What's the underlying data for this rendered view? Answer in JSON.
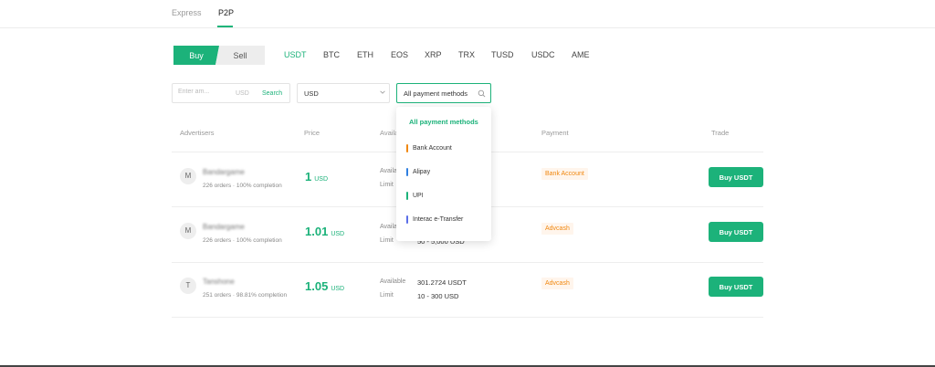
{
  "top_tabs": [
    {
      "label": "Express"
    },
    {
      "label": "P2P"
    }
  ],
  "trade_toggle": {
    "buy_label": "Buy",
    "sell_label": "Sell"
  },
  "coins": [
    "USDT",
    "BTC",
    "ETH",
    "EOS",
    "XRP",
    "TRX",
    "TUSD",
    "USDC",
    "AME"
  ],
  "filters": {
    "amount_placeholder": "Enter am...",
    "amount_unit": "USD",
    "search_label": "Search",
    "currency": "USD",
    "payment_method": "All payment methods"
  },
  "table": {
    "headers": [
      "Advertisers",
      "Price",
      "Availa",
      "Payment",
      "Trade"
    ],
    "available_label": "Available",
    "limit_label": "Limit",
    "rows": [
      {
        "initial": "M",
        "name": "Bandargame",
        "stats": "226 orders · 100% completion",
        "price": "1",
        "currency": "USD",
        "available": "",
        "limit": "",
        "payment": "Bank Account",
        "trade": "Buy USDT"
      },
      {
        "initial": "M",
        "name": "Bandargame",
        "stats": "226 orders · 100% completion",
        "price": "1.01",
        "currency": "USD",
        "available": "",
        "limit": "50 - 5,000 USD",
        "payment": "Advcash",
        "trade": "Buy USDT"
      },
      {
        "initial": "T",
        "name": "Tanshone",
        "stats": "251 orders · 98.81% completion",
        "price": "1.05",
        "currency": "USD",
        "available": "301.2724 USDT",
        "limit": "10 - 300 USD",
        "payment": "Advcash",
        "trade": "Buy USDT"
      }
    ]
  },
  "payment_dropdown": {
    "items": [
      {
        "label": "All payment methods",
        "color": "#1cb27a"
      },
      {
        "label": "Bank Account",
        "color": "#f0870f"
      },
      {
        "label": "Alipay",
        "color": "#2f7fe0"
      },
      {
        "label": "UPI",
        "color": "#1cb27a"
      },
      {
        "label": "Interac e-Transfer",
        "color": "#5b6ee8"
      }
    ]
  },
  "colors": {
    "accent": "#1cb27a",
    "tag_text": "#f0870f",
    "tag_bg": "#fff5ec"
  }
}
